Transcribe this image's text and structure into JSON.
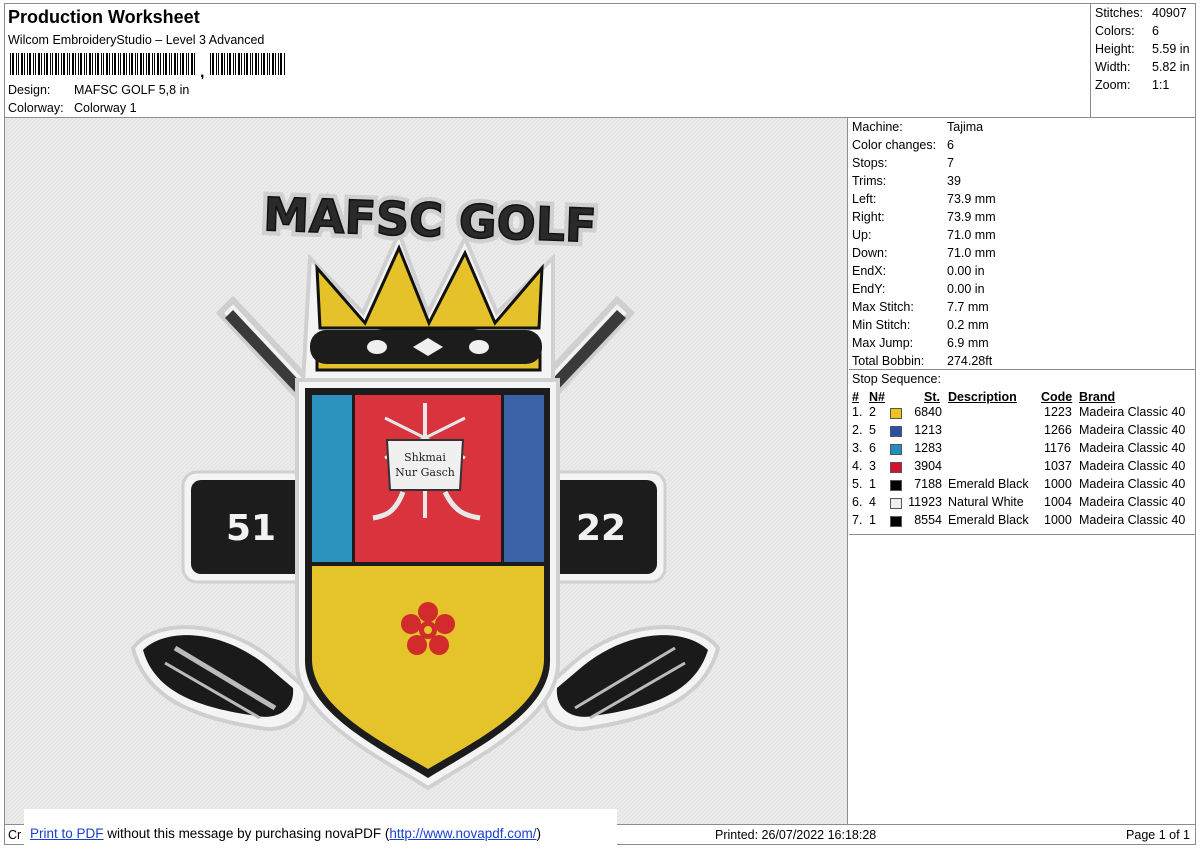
{
  "header": {
    "title": "Production Worksheet",
    "subtitle": "Wilcom EmbroideryStudio – Level 3 Advanced",
    "barcode_comma": ",",
    "design_label": "Design:",
    "design_value": "MAFSC GOLF 5,8 in",
    "colorway_label": "Colorway:",
    "colorway_value": "Colorway 1"
  },
  "summary": {
    "stitches_label": "Stitches:",
    "stitches_value": "40907",
    "colors_label": "Colors:",
    "colors_value": "6",
    "height_label": "Height:",
    "height_value": "5.59 in",
    "width_label": "Width:",
    "width_value": "5.82 in",
    "zoom_label": "Zoom:",
    "zoom_value": "1:1"
  },
  "design_image": {
    "arc_text": "MAFSC GOLF",
    "left_number": "51",
    "right_number": "22",
    "banner_text_line1": "Shkmai",
    "banner_text_line2": "Nur Gasch"
  },
  "machine_info": [
    {
      "label": "Machine:",
      "value": "Tajima"
    },
    {
      "label": "Color changes:",
      "value": "6"
    },
    {
      "label": "Stops:",
      "value": "7"
    },
    {
      "label": "Trims:",
      "value": "39"
    },
    {
      "label": "Left:",
      "value": "73.9 mm"
    },
    {
      "label": "Right:",
      "value": "73.9 mm"
    },
    {
      "label": "Up:",
      "value": "71.0 mm"
    },
    {
      "label": "Down:",
      "value": "71.0 mm"
    },
    {
      "label": "EndX:",
      "value": "0.00 in"
    },
    {
      "label": "EndY:",
      "value": "0.00 in"
    },
    {
      "label": "Max Stitch:",
      "value": "7.7 mm"
    },
    {
      "label": "Min Stitch:",
      "value": "0.2 mm"
    },
    {
      "label": "Max Jump:",
      "value": "6.9 mm"
    },
    {
      "label": "Total Bobbin:",
      "value": "274.28ft"
    }
  ],
  "stop_sequence": {
    "title": "Stop Sequence:",
    "columns": {
      "num": "#",
      "n": "N#",
      "st": "St.",
      "description": "Description",
      "code": "Code",
      "brand": "Brand"
    },
    "rows": [
      {
        "num": "1.",
        "n": "2",
        "color": "#f1c21b",
        "st": "6840",
        "description": "",
        "code": "1223",
        "brand": "Madeira Classic 40"
      },
      {
        "num": "2.",
        "n": "5",
        "color": "#2a4fa3",
        "st": "1213",
        "description": "",
        "code": "1266",
        "brand": "Madeira Classic 40"
      },
      {
        "num": "3.",
        "n": "6",
        "color": "#1f8fbf",
        "st": "1283",
        "description": "",
        "code": "1176",
        "brand": "Madeira Classic 40"
      },
      {
        "num": "4.",
        "n": "3",
        "color": "#d3132b",
        "st": "3904",
        "description": "",
        "code": "1037",
        "brand": "Madeira Classic 40"
      },
      {
        "num": "5.",
        "n": "1",
        "color": "#000000",
        "st": "7188",
        "description": "Emerald Black",
        "code": "1000",
        "brand": "Madeira Classic 40"
      },
      {
        "num": "6.",
        "n": "4",
        "color": "#eeeeee",
        "st": "11923",
        "description": "Natural White",
        "code": "1004",
        "brand": "Madeira Classic 40"
      },
      {
        "num": "7.",
        "n": "1",
        "color": "#000000",
        "st": "8554",
        "description": "Emerald Black",
        "code": "1000",
        "brand": "Madeira Classic 40"
      }
    ]
  },
  "footer": {
    "cr": "Cr",
    "nova_link": "Print to PDF",
    "nova_text": " without this message by purchasing novaPDF (",
    "nova_url": "http://www.novapdf.com/",
    "nova_close": ")",
    "printed": "Printed: 26/07/2022 16:18:28",
    "page": "Page 1 of 1"
  }
}
